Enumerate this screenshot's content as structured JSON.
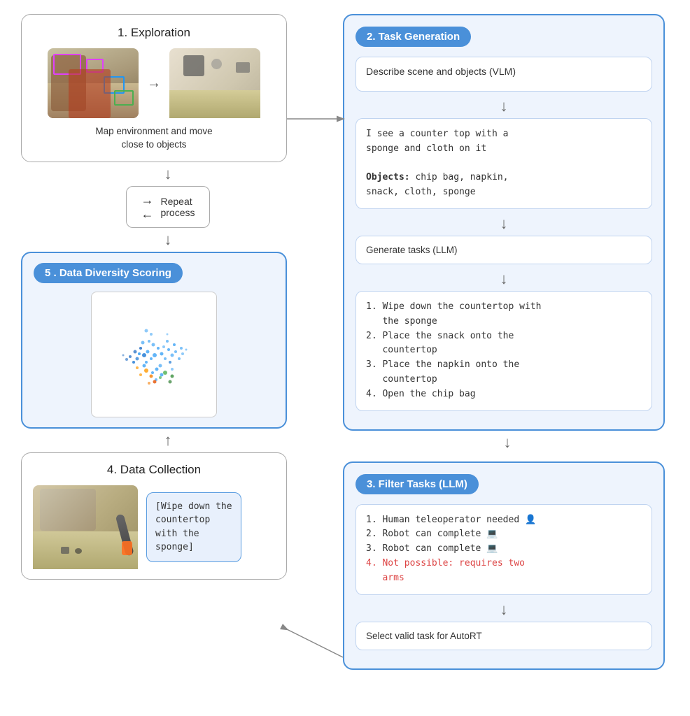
{
  "sections": {
    "exploration": {
      "title": "1. Exploration",
      "description": "Map environment and move\nclose to objects"
    },
    "repeat": {
      "label": "Repeat\nprocess"
    },
    "diversity": {
      "title": "5 . Data Diversity Scoring"
    },
    "collection": {
      "title": "4. Data Collection",
      "task_label": "[Wipe down the\ncountertop\nwith the\nsponge]"
    },
    "task_generation": {
      "title": "2. Task Generation",
      "describe_label": "Describe scene and objects (VLM)",
      "vlm_output": "I see a counter top with a\nsponge and cloth on it\n\nObjects: chip bag, napkin,\nsnack, cloth, sponge",
      "generate_label": "Generate tasks (LLM)",
      "tasks": [
        "1. Wipe down the countertop with\n   the sponge",
        "2. Place the snack onto the\n   countertop",
        "3. Place the napkin onto the\n   countertop",
        "4. Open the chip bag"
      ]
    },
    "filter": {
      "title": "3. Filter Tasks (LLM)",
      "items": [
        {
          "text": "1. Human teleoperator needed",
          "color": "normal",
          "icon": "person"
        },
        {
          "text": "2. Robot can complete",
          "color": "normal",
          "icon": "robot"
        },
        {
          "text": "3. Robot can complete",
          "color": "normal",
          "icon": "robot"
        },
        {
          "text": "4. Not possible: requires two\n   arms",
          "color": "red",
          "icon": "none"
        }
      ],
      "select_label": "Select valid task for AutoRT"
    }
  }
}
